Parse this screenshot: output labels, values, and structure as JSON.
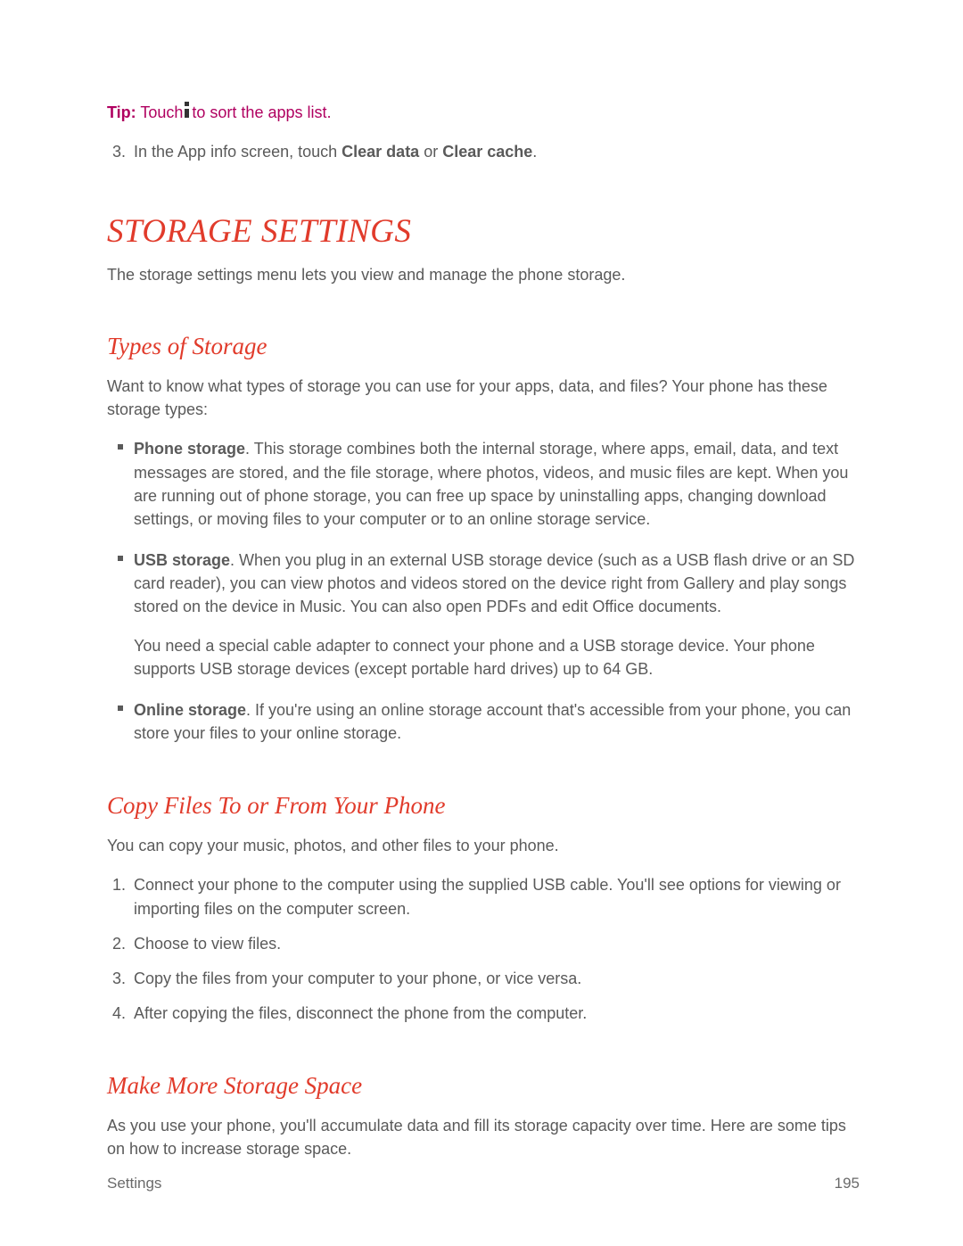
{
  "tip": {
    "label": "Tip:",
    "before": "Touch",
    "after": "to sort the apps list."
  },
  "step3": {
    "num": "3.",
    "pre": "In the App info screen, touch ",
    "bold1": "Clear data",
    "mid": " or ",
    "bold2": "Clear cache",
    "post": "."
  },
  "h1": "STORAGE SETTINGS",
  "intro": "The storage settings menu lets you view and manage the phone storage.",
  "types": {
    "heading": "Types of Storage",
    "intro": "Want to know what types of storage you can use for your apps, data, and files? Your phone has these storage types:",
    "items": [
      {
        "bold": "Phone storage",
        "text": ". This storage combines both the internal storage, where apps, email, data, and text messages are stored, and the file storage, where photos, videos, and music files are kept. When you are running out of phone storage, you can free up space by uninstalling apps, changing download settings, or moving files to your computer or to an online storage service."
      },
      {
        "bold": "USB storage",
        "text": ". When you plug in an external USB storage device (such as a USB flash drive or an SD card reader), you can view photos and videos stored on the device right from Gallery and play songs stored on the device in Music. You can also open PDFs and edit Office documents.",
        "para2": "You need a special cable adapter to connect your phone and a USB storage device. Your phone supports USB storage devices (except portable hard drives) up to 64 GB."
      },
      {
        "bold": "Online storage",
        "text": ". If you're using an online storage account that's accessible from your phone, you can store your files to your online storage."
      }
    ]
  },
  "copy": {
    "heading": "Copy Files To or From Your Phone",
    "intro": "You can copy your music, photos, and other files to your phone.",
    "steps": [
      "Connect your phone to the computer using the supplied USB cable. You'll see options for viewing or importing files on the computer screen.",
      "Choose to view files.",
      "Copy the files from your computer to your phone, or vice versa.",
      "After copying the files, disconnect the phone from the computer."
    ]
  },
  "more": {
    "heading": "Make More Storage Space",
    "intro": "As you use your phone, you'll accumulate data and fill its storage capacity over time. Here are some tips on how to increase storage space."
  },
  "footer": {
    "section": "Settings",
    "page": "195"
  }
}
